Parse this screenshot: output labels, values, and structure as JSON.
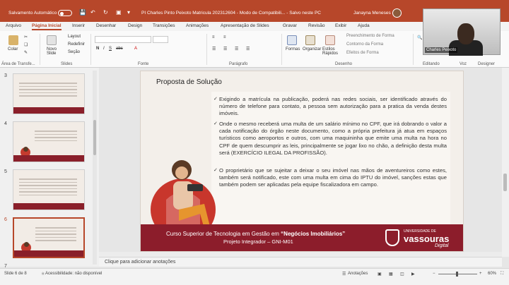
{
  "titlebar": {
    "autosave_label": "Salvamento Automático",
    "document_title": "PI Charles Pinto Peixoto Matricula 202312604  -  Modo de Compatibili...  -  Salvo neste PC",
    "user_name": "Janayna Meneses"
  },
  "tabs": [
    "Arquivo",
    "Página Inicial",
    "Inserir",
    "Desenhar",
    "Design",
    "Transições",
    "Animações",
    "Apresentação de Slides",
    "Gravar",
    "Revisão",
    "Exibir",
    "Ajuda"
  ],
  "ribbon": {
    "clipboard": {
      "paste": "Colar",
      "group": "Área de Transfe..."
    },
    "slides": {
      "new_slide": "Novo Slide",
      "layout": "Layout",
      "reset": "Redefinir",
      "section": "Seção",
      "group": "Slides"
    },
    "font_group": "Fonte",
    "paragraph_group": "Parágrafo",
    "drawing": {
      "shapes": "Formas",
      "arrange": "Organizar",
      "quick_styles": "Estilos Rápidos",
      "fill": "Preenchimento de Forma",
      "outline": "Contorno da Forma",
      "effects": "Efeitos de Forma",
      "group": "Desenho"
    },
    "editing_group": "Editando",
    "voice_group": "Voz",
    "designer_group": "Designer"
  },
  "video": {
    "participant": "Charles Peixoto"
  },
  "thumbnails": [
    {
      "number": "3"
    },
    {
      "number": "4"
    },
    {
      "number": "5"
    },
    {
      "number": "6"
    },
    {
      "number": "7"
    }
  ],
  "slide": {
    "title": "Proposta de Solução",
    "bullets": [
      "Exigindo a matrícula na publicação, poderá nas redes sociais, ser identificado através do número de telefone para contato, a pessoa sem autorização para a pratica da venda destes imóveis.",
      "Onde o mesmo receberá uma multa de um salário mínimo no CPF, que irá dobrando o valor a cada notificação do órgão neste documento, como a própria prefeitura já atua em espaços turísticos como aeroportos e outros, com uma maquininha que emite uma multa na hora no CPF de quem descumprir as leis, principalmente se jogar lixo no chão, a definição desta multa será (EXERCÍCIO ILEGAL DA PROFISSÃO).",
      "O proprietário que se sujeitar a deixar o seu imóvel nas mãos de aventureiros como estes, também será notificado, este com uma multa em cima do IPTU do imóvel, sanções estas que também podem ser aplicadas pela equipe fiscalizadora em campo."
    ],
    "footer_course_prefix": "Curso Superior de Tecnologia em Gestão em ",
    "footer_course_name": "“Negócios Imobiliários”",
    "footer_project": "Projeto Integrador – GNI-M01",
    "university_line1": "UNIVERSIDADE DE",
    "university_line2": "vassouras",
    "university_line3": "Digital"
  },
  "notes_placeholder": "Clique para adicionar anotações",
  "status": {
    "slide_counter": "Slide 6 de 8",
    "accessibility": "Acessibilidade: não disponível",
    "notes": "Anotações",
    "zoom": "60%"
  }
}
